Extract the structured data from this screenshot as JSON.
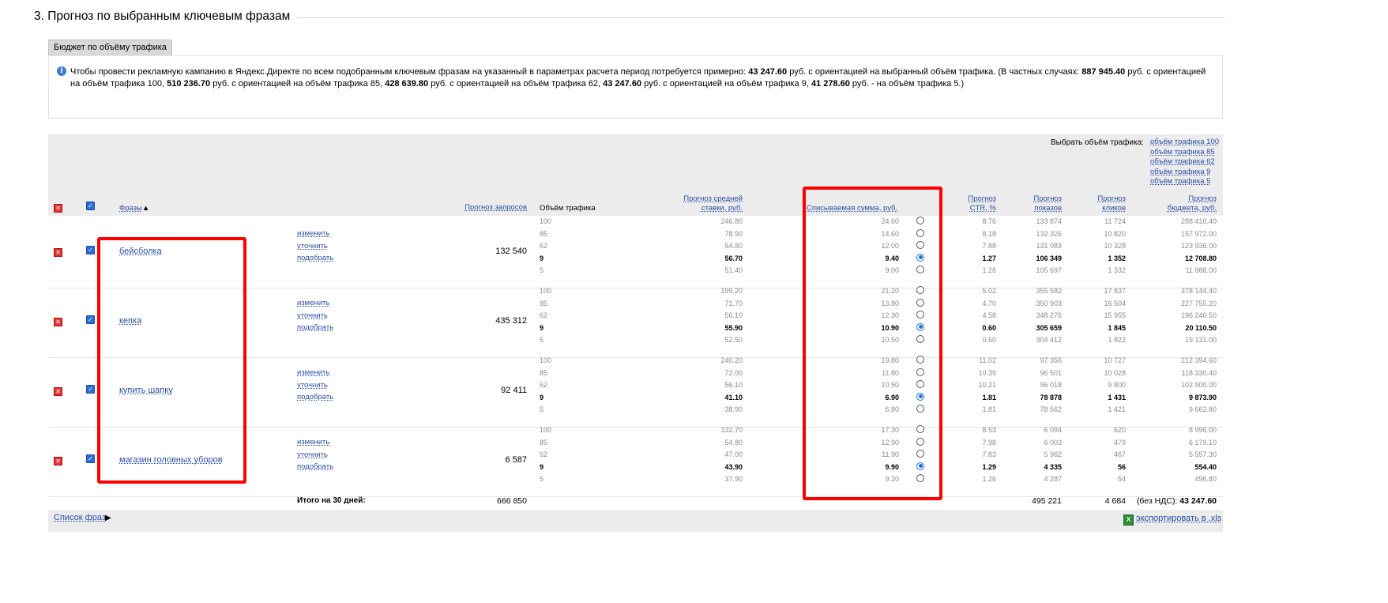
{
  "section_title": "3. Прогноз по выбранным ключевым фразам",
  "budget_tab": "Бюджет по объёму трафика",
  "info": {
    "p1": "Чтобы провести рекламную кампанию в Яндекс.Директе по всем подобранным ключевым фразам на указанный в параметрах расчета период потребуется примерно: ",
    "v1": "43 247.60",
    "p2": " руб. с ориентацией на выбранный объём трафика. (В частных случаях: ",
    "v2": "887 945.40",
    "p3": " руб. с ориентацией на объём трафика 100, ",
    "v3": "510 236.70",
    "p4": " руб. с ориентацией на объём трафика 85, ",
    "v4": "428 639.80",
    "p5": " руб. с ориентацией на объём трафика 62, ",
    "v5": "43 247.60",
    "p6": " руб. с ориентацией на объём трафика 9, ",
    "v6": "41 278.60",
    "p7": " руб. - на объём трафика 5.)"
  },
  "traffic_select": {
    "label": "Выбрать объём трафика:",
    "links": [
      "объём трафика 100",
      "объём трафика 85",
      "объём трафика 62",
      "объём трафика 9",
      "объём трафика 5"
    ]
  },
  "headers": {
    "phrases": "Фразы",
    "sort_arrow": "▲",
    "requests": "Прогноз запросов",
    "traffic": "Объём трафика",
    "bid_l1": "Прогноз средней",
    "bid_l2": "ставки, руб.",
    "charge": "Списываемая сумма, руб.",
    "ctr_l1": "Прогноз",
    "ctr_l2": "CTR, %",
    "shows_l1": "Прогноз",
    "shows_l2": "показов",
    "clicks_l1": "Прогноз",
    "clicks_l2": "кликов",
    "budget_l1": "Прогноз",
    "budget_l2": "бюджета, руб."
  },
  "actions": [
    "изменить",
    "уточнить",
    "подобрать"
  ],
  "rows": [
    {
      "phrase": "бейсболка",
      "requests": "132 540",
      "traffic": [
        "100",
        "85",
        "62",
        "9",
        "5"
      ],
      "bid": [
        "246.80",
        "78.90",
        "54.80",
        "56.70",
        "51.40"
      ],
      "charge": [
        "24.60",
        "14.60",
        "12.00",
        "9.40",
        "9.00"
      ],
      "ctr": [
        "8.76",
        "8.18",
        "7.88",
        "1.27",
        "1.26"
      ],
      "shows": [
        "133 874",
        "132 326",
        "131 083",
        "106 349",
        "105 697"
      ],
      "clicks": [
        "11 724",
        "10 820",
        "10 328",
        "1 352",
        "1 332"
      ],
      "budget": [
        "288 410.40",
        "157 972.00",
        "123 936.00",
        "12 708.80",
        "11 988.00"
      ],
      "selected": 3
    },
    {
      "phrase": "кепка",
      "requests": "435 312",
      "traffic": [
        "100",
        "85",
        "62",
        "9",
        "5"
      ],
      "bid": [
        "199.20",
        "71.70",
        "56.10",
        "55.90",
        "52.50"
      ],
      "charge": [
        "21.20",
        "13.80",
        "12.30",
        "10.90",
        "10.50"
      ],
      "ctr": [
        "5.02",
        "4.70",
        "4.58",
        "0.60",
        "0.60"
      ],
      "shows": [
        "355 582",
        "350 903",
        "348 276",
        "305 659",
        "304 412"
      ],
      "clicks": [
        "17 837",
        "16 504",
        "15 955",
        "1 845",
        "1 822"
      ],
      "budget": [
        "378 144.40",
        "227 755.20",
        "196 246.50",
        "20 110.50",
        "19 131.00"
      ],
      "selected": 3
    },
    {
      "phrase": "купить шапку",
      "requests": "92 411",
      "traffic": [
        "100",
        "85",
        "62",
        "9",
        "5"
      ],
      "bid": [
        "240.20",
        "72.00",
        "56.10",
        "41.10",
        "38.90"
      ],
      "charge": [
        "19.80",
        "11.80",
        "10.50",
        "6.90",
        "6.80"
      ],
      "ctr": [
        "11.02",
        "10.39",
        "10.21",
        "1.81",
        "1.81"
      ],
      "shows": [
        "97 356",
        "96 501",
        "96 018",
        "78 878",
        "78 562"
      ],
      "clicks": [
        "10 727",
        "10 028",
        "9 800",
        "1 431",
        "1 421"
      ],
      "budget": [
        "212 394.60",
        "118 330.40",
        "102 900.00",
        "9 873.90",
        "9 662.80"
      ],
      "selected": 3
    },
    {
      "phrase": "магазин головных уборов",
      "requests": "6 587",
      "traffic": [
        "100",
        "85",
        "62",
        "9",
        "5"
      ],
      "bid": [
        "132.70",
        "54.80",
        "47.00",
        "43.90",
        "37.90"
      ],
      "charge": [
        "17.30",
        "12.90",
        "11.90",
        "9.90",
        "9.20"
      ],
      "ctr": [
        "8.53",
        "7.98",
        "7.83",
        "1.29",
        "1.26"
      ],
      "shows": [
        "6 094",
        "6 003",
        "5 962",
        "4 335",
        "4 287"
      ],
      "clicks": [
        "520",
        "479",
        "467",
        "56",
        "54"
      ],
      "budget": [
        "8 996.00",
        "6 179.10",
        "5 557.30",
        "554.40",
        "496.80"
      ],
      "selected": 3
    }
  ],
  "totals": {
    "label": "Итого на 30 дней:",
    "requests": "666 850",
    "shows": "495 221",
    "clicks": "4 684",
    "budget_prefix": "(без НДС): ",
    "budget": "43 247.60"
  },
  "footer": {
    "phrase_list": "Список фраз",
    "phrase_list_arrow": "▶",
    "export": "экспортировать в .xls"
  },
  "colors": {
    "link": "#2a4ea3",
    "highlight": "#ff0000",
    "header_bg": "#ececec"
  }
}
